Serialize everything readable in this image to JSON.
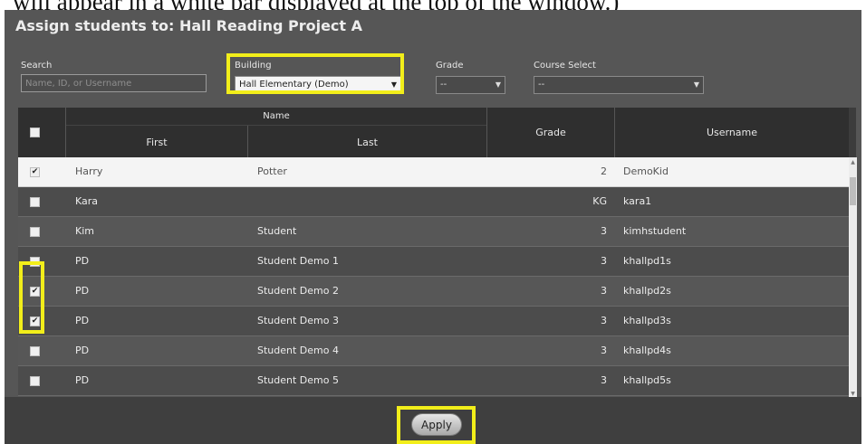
{
  "caption_text": "will appear in a white bar displayed at the top of the window.)",
  "dialog": {
    "title": "Assign students to: Hall Reading Project A",
    "filters": {
      "search_label": "Search",
      "search_placeholder": "Name, ID, or Username",
      "building_label": "Building",
      "building_value": "Hall Elementary (Demo)",
      "grade_label": "Grade",
      "grade_value": "--",
      "course_label": "Course Select",
      "course_value": "--"
    },
    "table": {
      "name_group_header": "Name",
      "headers": {
        "first": "First",
        "last": "Last",
        "grade": "Grade",
        "username": "Username"
      },
      "rows": [
        {
          "checked": true,
          "first": "Harry",
          "last": "Potter",
          "grade": "2",
          "username": "DemoKid"
        },
        {
          "checked": false,
          "first": "Kara",
          "last": "",
          "grade": "KG",
          "username": "kara1"
        },
        {
          "checked": false,
          "first": "Kim",
          "last": "Student",
          "grade": "3",
          "username": "kimhstudent"
        },
        {
          "checked": false,
          "first": "PD",
          "last": "Student Demo 1",
          "grade": "3",
          "username": "khallpd1s"
        },
        {
          "checked": true,
          "first": "PD",
          "last": "Student Demo 2",
          "grade": "3",
          "username": "khallpd2s"
        },
        {
          "checked": true,
          "first": "PD",
          "last": "Student Demo 3",
          "grade": "3",
          "username": "khallpd3s"
        },
        {
          "checked": false,
          "first": "PD",
          "last": "Student Demo 4",
          "grade": "3",
          "username": "khallpd4s"
        },
        {
          "checked": false,
          "first": "PD",
          "last": "Student Demo 5",
          "grade": "3",
          "username": "khallpd5s"
        }
      ]
    },
    "apply_label": "Apply"
  },
  "colors": {
    "highlight": "#f2ee1a",
    "dialog_bg": "#565656",
    "header_bg": "#2f2f2f"
  }
}
